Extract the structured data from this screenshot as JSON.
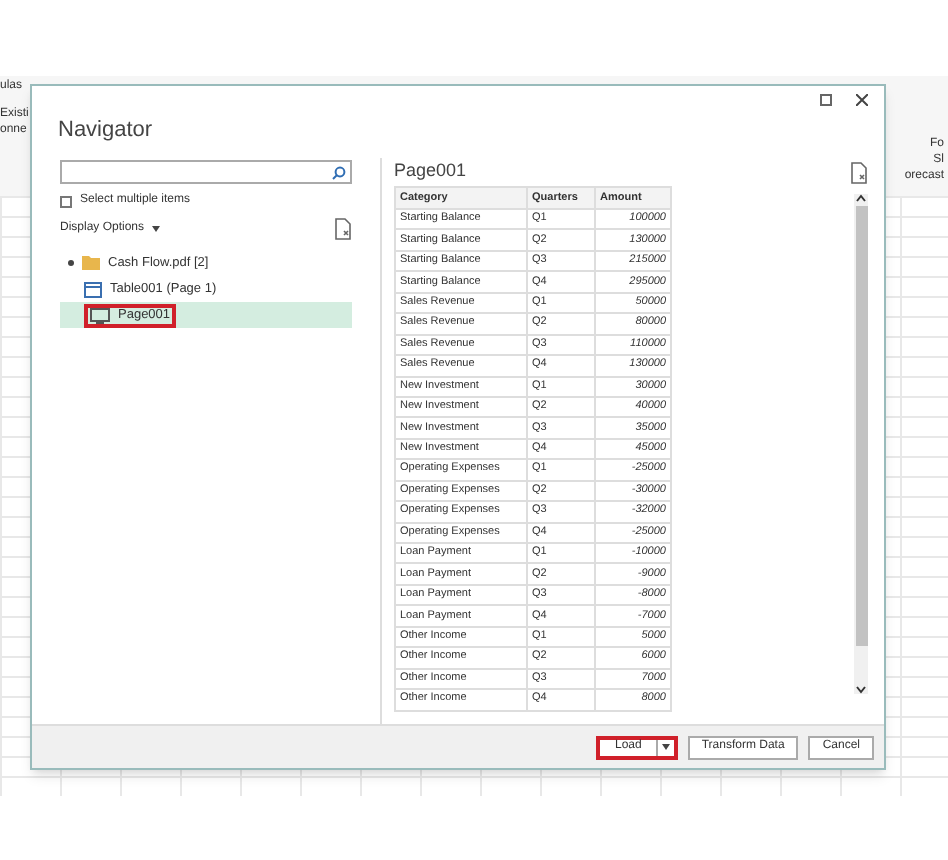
{
  "background": {
    "left_texts": [
      "ulas",
      "Existi",
      "onne"
    ],
    "right_texts": [
      "Fo",
      "Sl",
      "orecast"
    ]
  },
  "dialog": {
    "title": "Navigator",
    "select_multiple": {
      "label": "Select multiple items",
      "checked": false
    },
    "display_options": "Display Options",
    "tree": [
      {
        "label": "Cash Flow.pdf [2]",
        "expanded": true,
        "selected": false,
        "highlighted": false,
        "children": [
          {
            "label": "Table001 (Page 1)",
            "kind": "table",
            "selected": false,
            "highlighted": false
          },
          {
            "label": "Page001",
            "kind": "page",
            "selected": true,
            "highlighted": true
          }
        ]
      }
    ],
    "preview": {
      "title": "Page001",
      "columns": [
        "Category",
        "Quarters",
        "Amount"
      ],
      "rows": [
        [
          "Starting Balance",
          "Q1",
          "100000"
        ],
        [
          "Starting Balance",
          "Q2",
          "130000"
        ],
        [
          "Starting Balance",
          "Q3",
          "215000"
        ],
        [
          "Starting Balance",
          "Q4",
          "295000"
        ],
        [
          "Sales Revenue",
          "Q1",
          "50000"
        ],
        [
          "Sales Revenue",
          "Q2",
          "80000"
        ],
        [
          "Sales Revenue",
          "Q3",
          "110000"
        ],
        [
          "Sales Revenue",
          "Q4",
          "130000"
        ],
        [
          "New Investment",
          "Q1",
          "30000"
        ],
        [
          "New Investment",
          "Q2",
          "40000"
        ],
        [
          "New Investment",
          "Q3",
          "35000"
        ],
        [
          "New Investment",
          "Q4",
          "45000"
        ],
        [
          "Operating Expenses",
          "Q1",
          "-25000"
        ],
        [
          "Operating Expenses",
          "Q2",
          "-30000"
        ],
        [
          "Operating Expenses",
          "Q3",
          "-32000"
        ],
        [
          "Operating Expenses",
          "Q4",
          "-25000"
        ],
        [
          "Loan Payment",
          "Q1",
          "-10000"
        ],
        [
          "Loan Payment",
          "Q2",
          "-9000"
        ],
        [
          "Loan Payment",
          "Q3",
          "-8000"
        ],
        [
          "Loan Payment",
          "Q4",
          "-7000"
        ],
        [
          "Other Income",
          "Q1",
          "5000"
        ],
        [
          "Other Income",
          "Q2",
          "6000"
        ],
        [
          "Other Income",
          "Q3",
          "7000"
        ],
        [
          "Other Income",
          "Q4",
          "8000"
        ]
      ]
    },
    "buttons": [
      {
        "label": "Load",
        "kind": "split",
        "highlighted": true
      },
      {
        "label": "Transform Data",
        "kind": "plain",
        "highlighted": false
      },
      {
        "label": "Cancel",
        "kind": "plain",
        "highlighted": false
      }
    ]
  }
}
